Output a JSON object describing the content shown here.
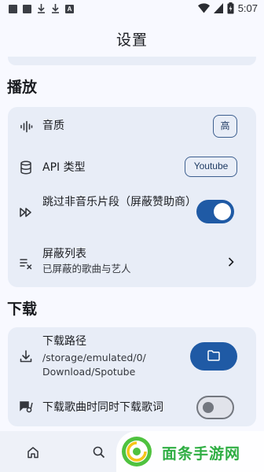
{
  "status_bar": {
    "time": "5:07",
    "notification_icons": [
      "square-icon",
      "square-icon",
      "download-icon",
      "download-icon",
      "a-badge-icon"
    ],
    "a_badge": "A"
  },
  "appbar": {
    "title": "设置"
  },
  "playback": {
    "title": "播放",
    "quality": {
      "label": "音质",
      "value": "高"
    },
    "api_type": {
      "label": "API 类型",
      "value": "Youtube"
    },
    "skip_non_music": {
      "label": "跳过非音乐片段（屏蔽赞助商）",
      "enabled": true
    },
    "blocklist": {
      "label": "屏蔽列表",
      "sub": "已屏蔽的歌曲与艺人"
    }
  },
  "download": {
    "title": "下载",
    "path": {
      "label": "下载路径",
      "value_line1": "/storage/emulated/0/",
      "value_line2": "Download/Spotube"
    },
    "lyrics_with_song": {
      "label": "下载歌曲时同时下载歌词",
      "enabled": false
    }
  },
  "bottom_nav": [
    "home-icon",
    "search-icon"
  ],
  "watermark": {
    "text": "面条手游网"
  },
  "colors": {
    "accent": "#1f5aa5",
    "card": "#e8edf7",
    "background": "#f8f9ff",
    "watermark": "#2fae43"
  }
}
